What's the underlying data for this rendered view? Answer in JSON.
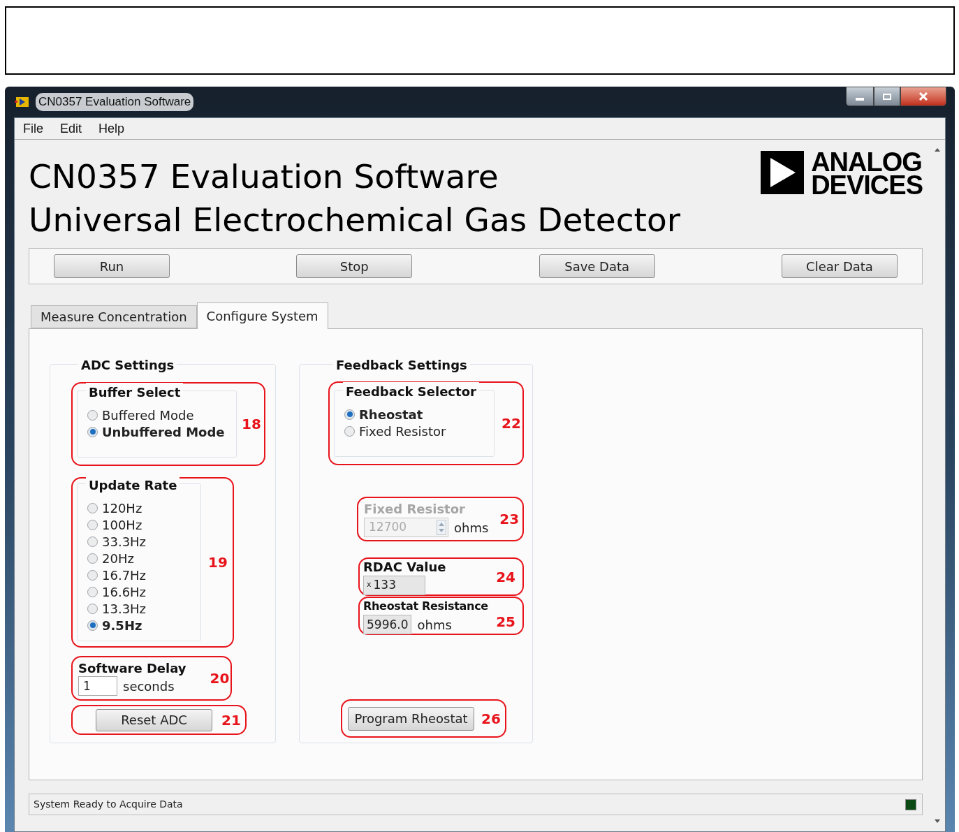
{
  "window": {
    "title": "CN0357 Evaluation Software"
  },
  "menu": [
    "File",
    "Edit",
    "Help"
  ],
  "heading": [
    "CN0357 Evaluation Software",
    "Universal Electrochemical Gas Detector"
  ],
  "logo": [
    "ANALOG",
    "DEVICES"
  ],
  "toolbar": [
    "Run",
    "Stop",
    "Save Data",
    "Clear Data"
  ],
  "tabs": [
    {
      "label": "Measure Concentration",
      "selected": false
    },
    {
      "label": "Configure System",
      "selected": true
    }
  ],
  "adc_settings": {
    "title": "ADC Settings",
    "buffer_select": {
      "title": "Buffer Select",
      "callout": "18",
      "options": [
        {
          "label": "Buffered Mode",
          "selected": false
        },
        {
          "label": "Unbuffered Mode",
          "selected": true
        }
      ]
    },
    "update_rate": {
      "title": "Update Rate",
      "callout": "19",
      "options": [
        {
          "label": "120Hz",
          "selected": false
        },
        {
          "label": "100Hz",
          "selected": false
        },
        {
          "label": "33.3Hz",
          "selected": false
        },
        {
          "label": "20Hz",
          "selected": false
        },
        {
          "label": "16.7Hz",
          "selected": false
        },
        {
          "label": "16.6Hz",
          "selected": false
        },
        {
          "label": "13.3Hz",
          "selected": false
        },
        {
          "label": "9.5Hz",
          "selected": true
        }
      ]
    },
    "software_delay": {
      "title": "Software Delay",
      "value": "1",
      "unit": "seconds",
      "callout": "20"
    },
    "reset": {
      "label": "Reset ADC",
      "callout": "21"
    }
  },
  "feedback_settings": {
    "title": "Feedback Settings",
    "selector": {
      "title": "Feedback Selector",
      "callout": "22",
      "options": [
        {
          "label": "Rheostat",
          "selected": true
        },
        {
          "label": "Fixed Resistor",
          "selected": false
        }
      ]
    },
    "fixed_resistor": {
      "title": "Fixed Resistor",
      "value": "12700",
      "unit": "ohms",
      "disabled": true,
      "callout": "23"
    },
    "rdac": {
      "title": "RDAC Value",
      "radix": "x",
      "value": "133",
      "callout": "24"
    },
    "rheostat_resistance": {
      "title": "Rheostat Resistance",
      "value": "5996.0",
      "unit": "ohms",
      "callout": "25"
    },
    "program": {
      "label": "Program Rheostat",
      "callout": "26"
    }
  },
  "status_bar": {
    "text": "System Ready to Acquire Data",
    "lit": false
  }
}
